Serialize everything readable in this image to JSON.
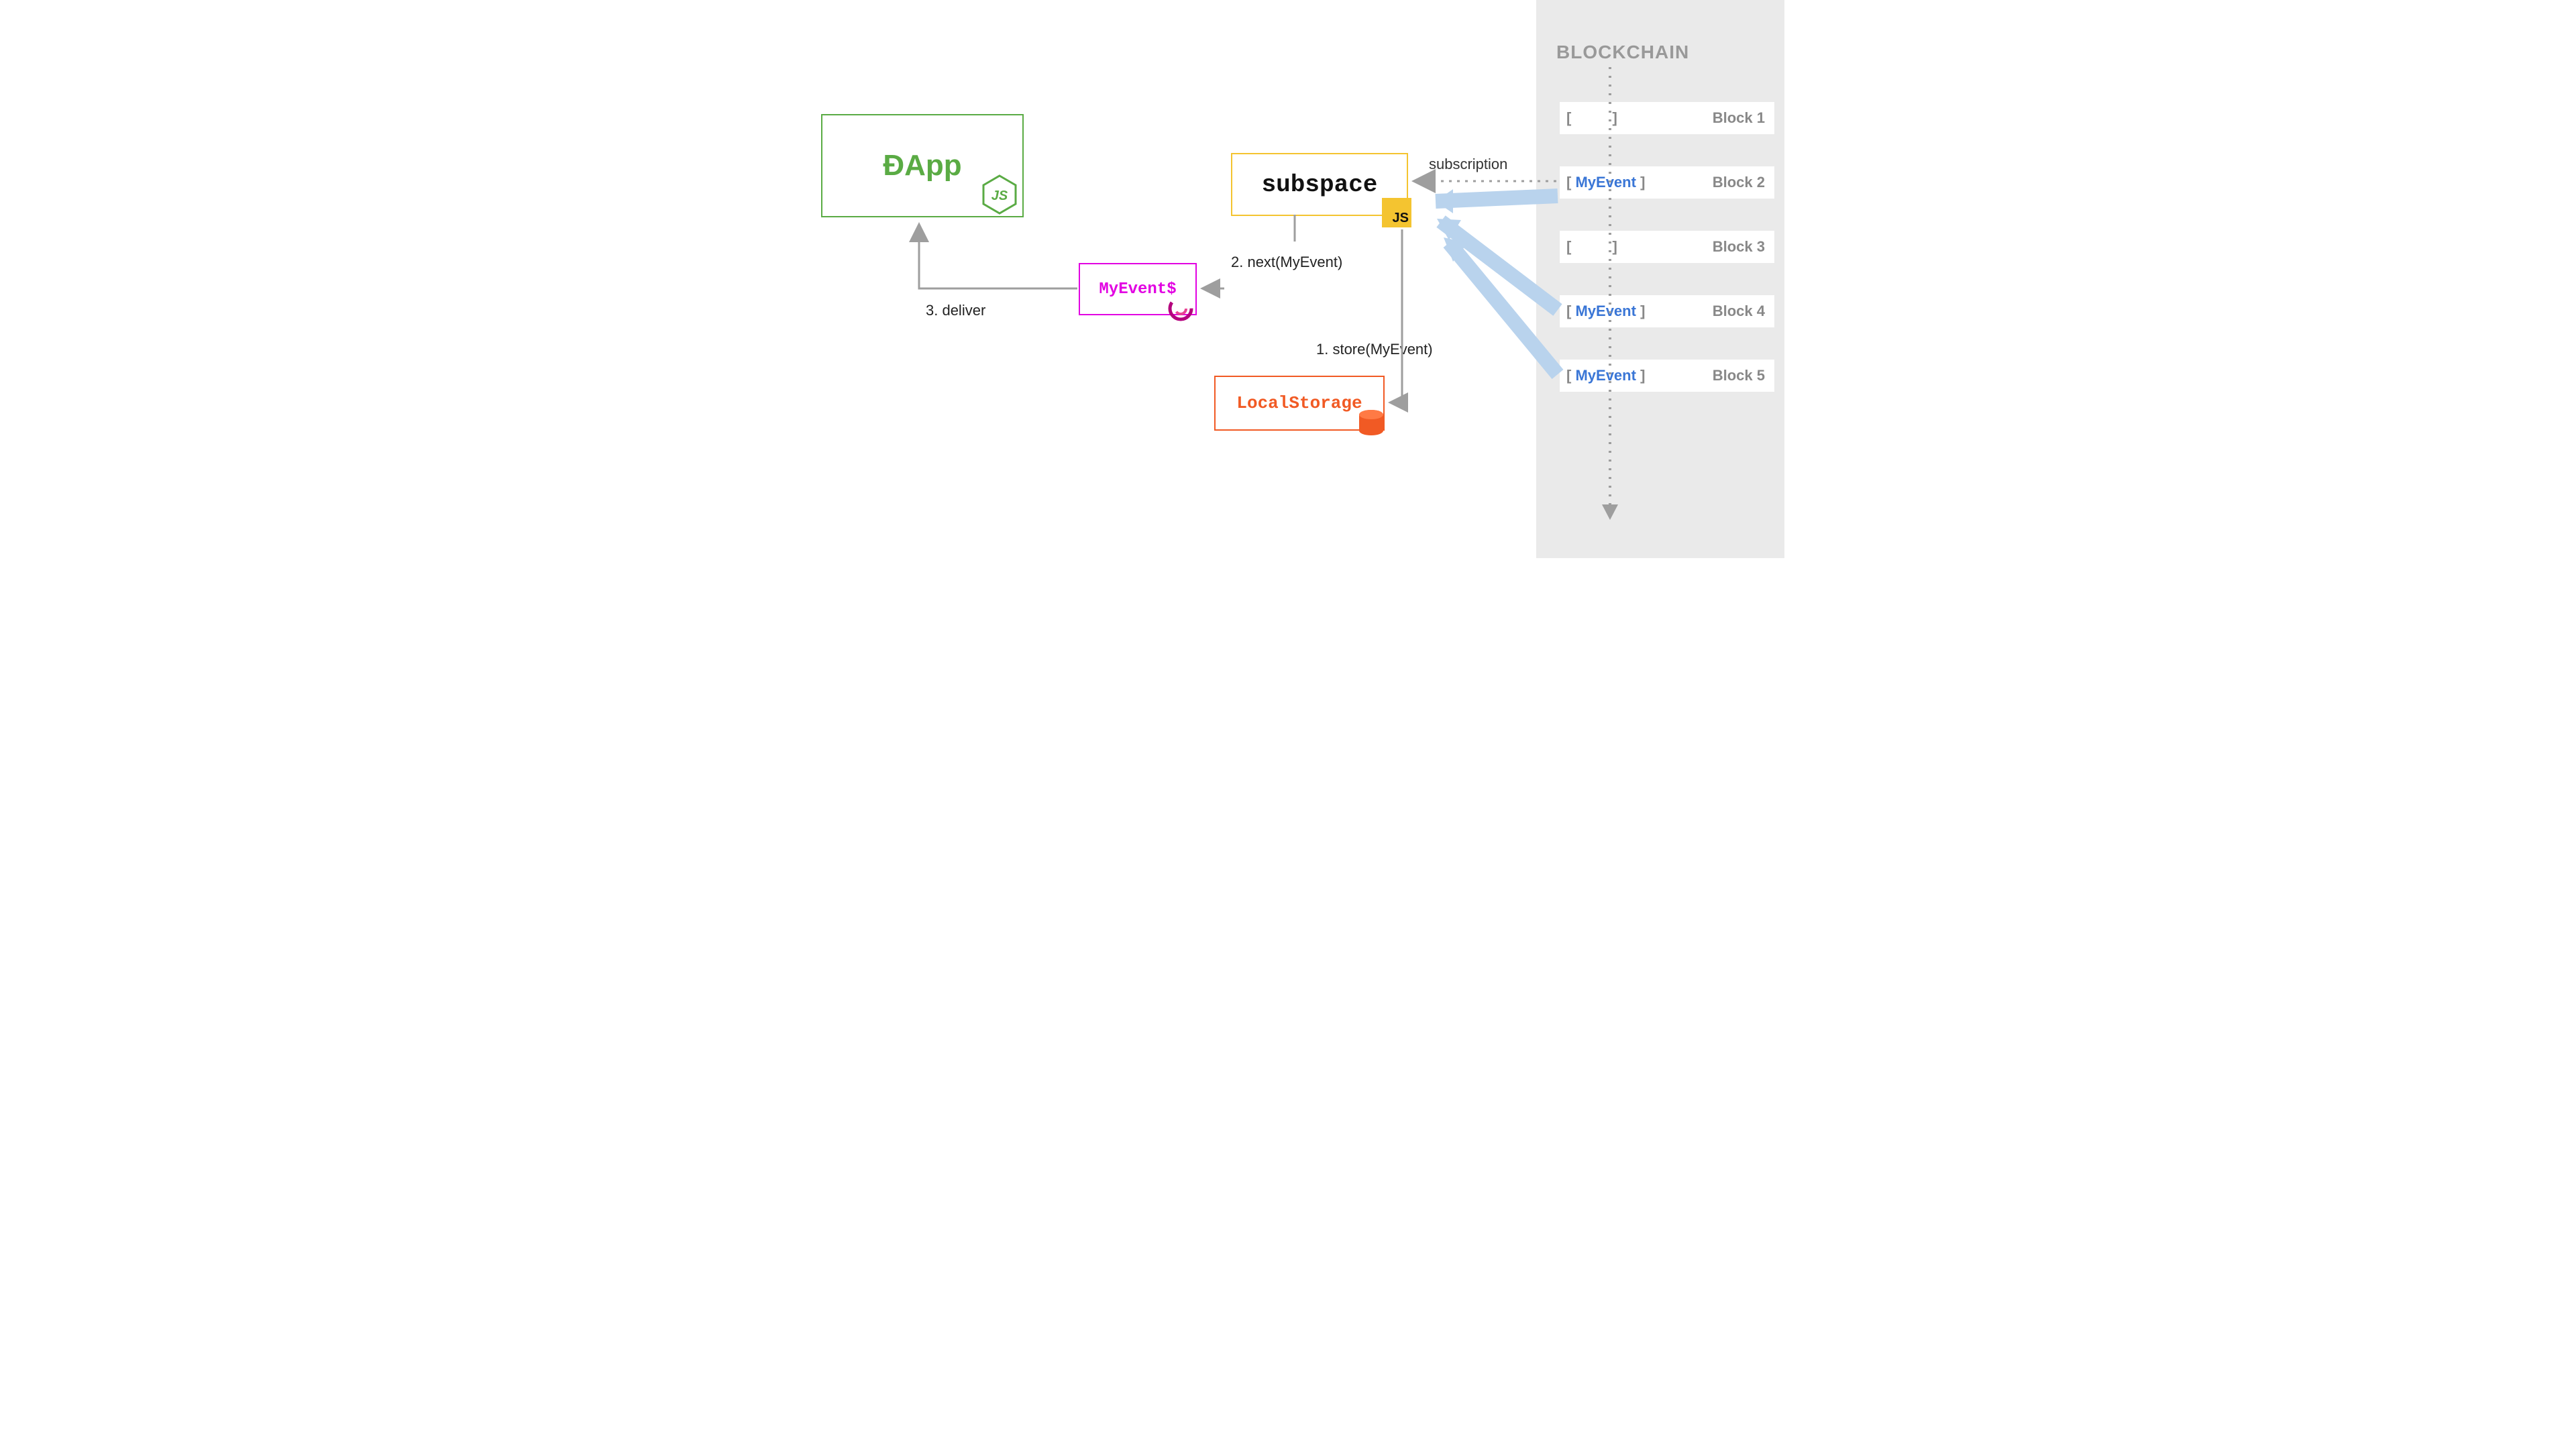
{
  "dapp": {
    "label": "ÐApp"
  },
  "subspace": {
    "label": "subspace",
    "badge": "JS"
  },
  "myevent": {
    "label": "MyEvent$"
  },
  "localstorage": {
    "label": "LocalStorage"
  },
  "labels": {
    "deliver": "3. deliver",
    "next": "2. next(MyEvent)",
    "store": "1. store(MyEvent)",
    "subscription": "subscription"
  },
  "blockchain": {
    "title": "BLOCKCHAIN",
    "blocks": [
      {
        "left": "[",
        "event": "",
        "right": "]",
        "name": "Block 1"
      },
      {
        "left": "[",
        "event": "MyEvent",
        "right": "]",
        "name": "Block 2"
      },
      {
        "left": "[",
        "event": "",
        "right": "]",
        "name": "Block 3"
      },
      {
        "left": "[",
        "event": "MyEvent",
        "right": "]",
        "name": "Block 4"
      },
      {
        "left": "[",
        "event": "MyEvent",
        "right": "]",
        "name": "Block 5"
      }
    ]
  },
  "colors": {
    "dapp": "#5aab44",
    "subspace_border": "#f4c430",
    "myevent": "#e200e2",
    "localstorage": "#f15a24",
    "blockchain_bg": "#eaeaea",
    "event_text": "#3a76d6",
    "arrow_blue": "#b9d3ed",
    "arrow_grey": "#9e9e9e"
  }
}
